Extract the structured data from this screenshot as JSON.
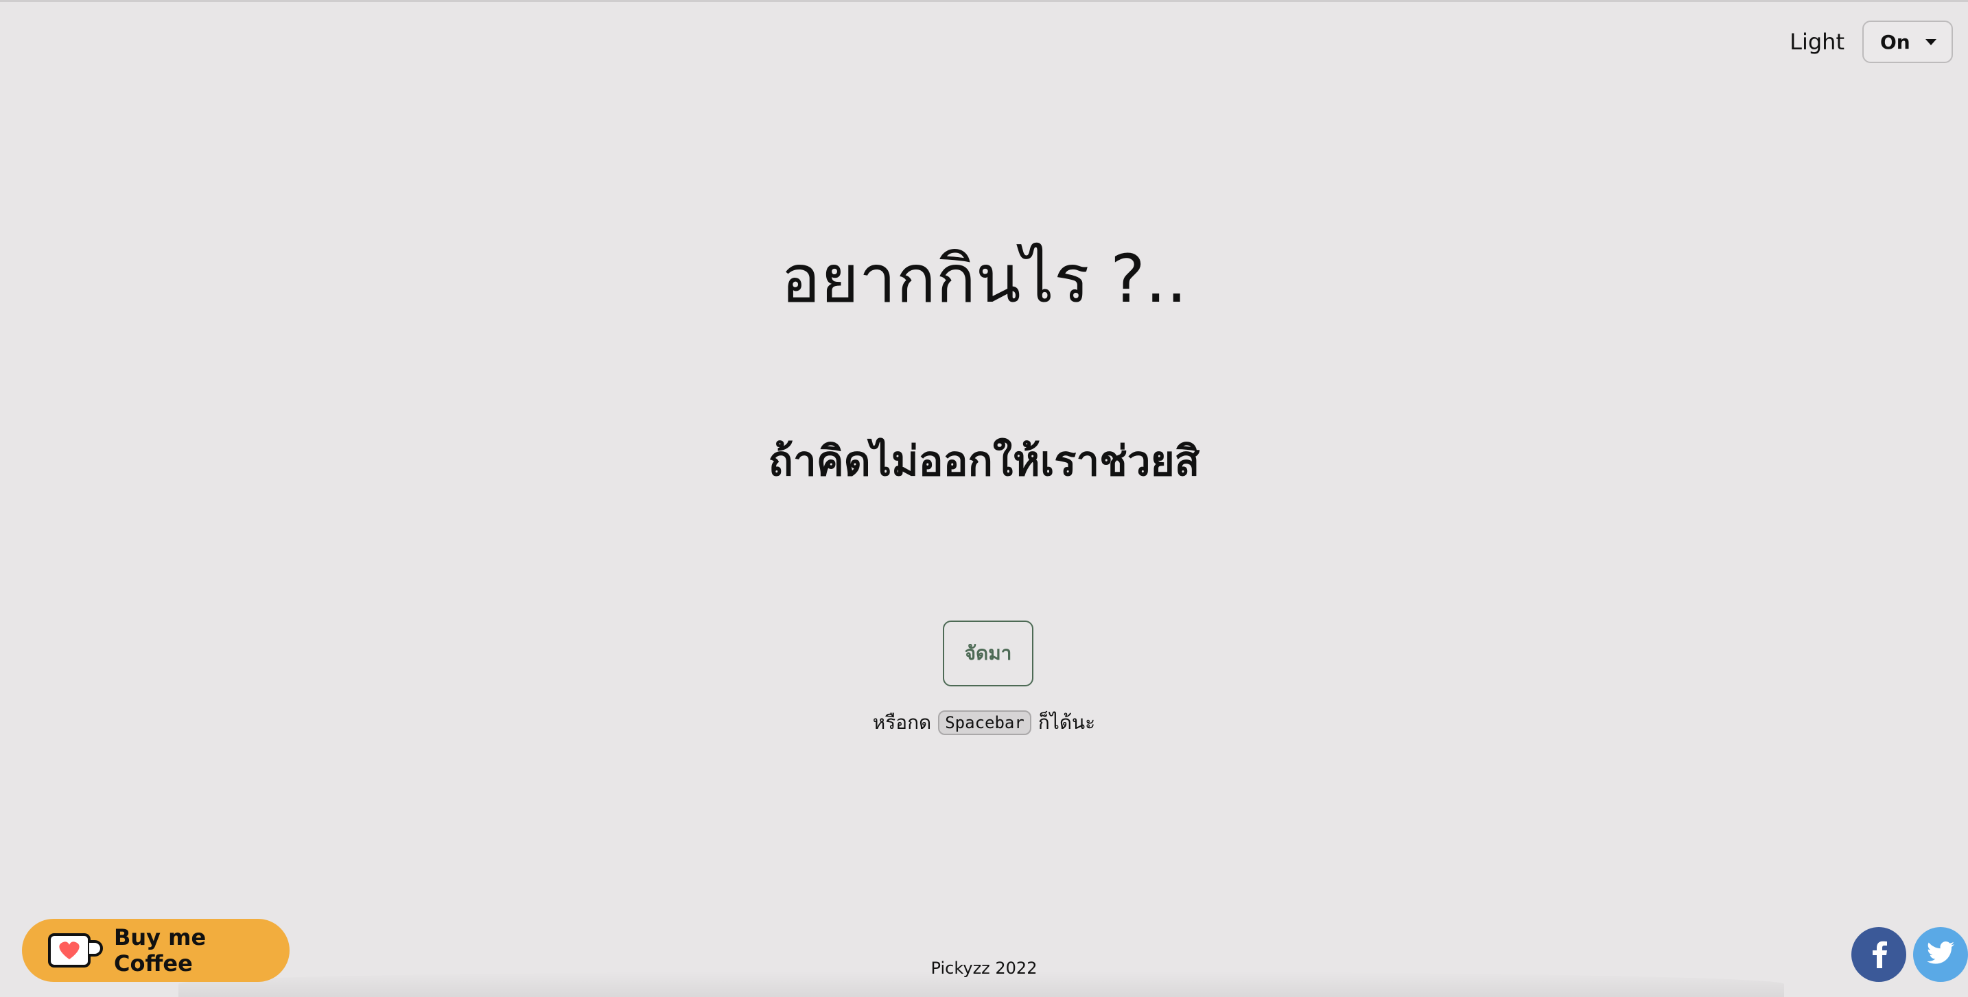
{
  "theme": {
    "label": "Light",
    "selected": "On"
  },
  "main": {
    "title": "อยากกินไร ?..",
    "subtitle": "ถ้าคิดไม่ออกให้เราช่วยสิ",
    "button_label": "จัดมา",
    "hint_prefix": "หรือกด",
    "hint_key": "Spacebar",
    "hint_suffix": "ก็ได้นะ"
  },
  "footer": {
    "copyright": "Pickyzz 2022",
    "coffee_label": "Buy me Coffee",
    "coffee_icon": "coffee-heart-icon",
    "social": [
      {
        "name": "facebook",
        "icon": "facebook-icon",
        "color": "#3b5998"
      },
      {
        "name": "twitter",
        "icon": "twitter-icon",
        "color": "#5aa9e6"
      }
    ]
  },
  "colors": {
    "background": "#e8e6e7",
    "accent": "#4d6a55",
    "coffee": "#f2ad3e"
  }
}
